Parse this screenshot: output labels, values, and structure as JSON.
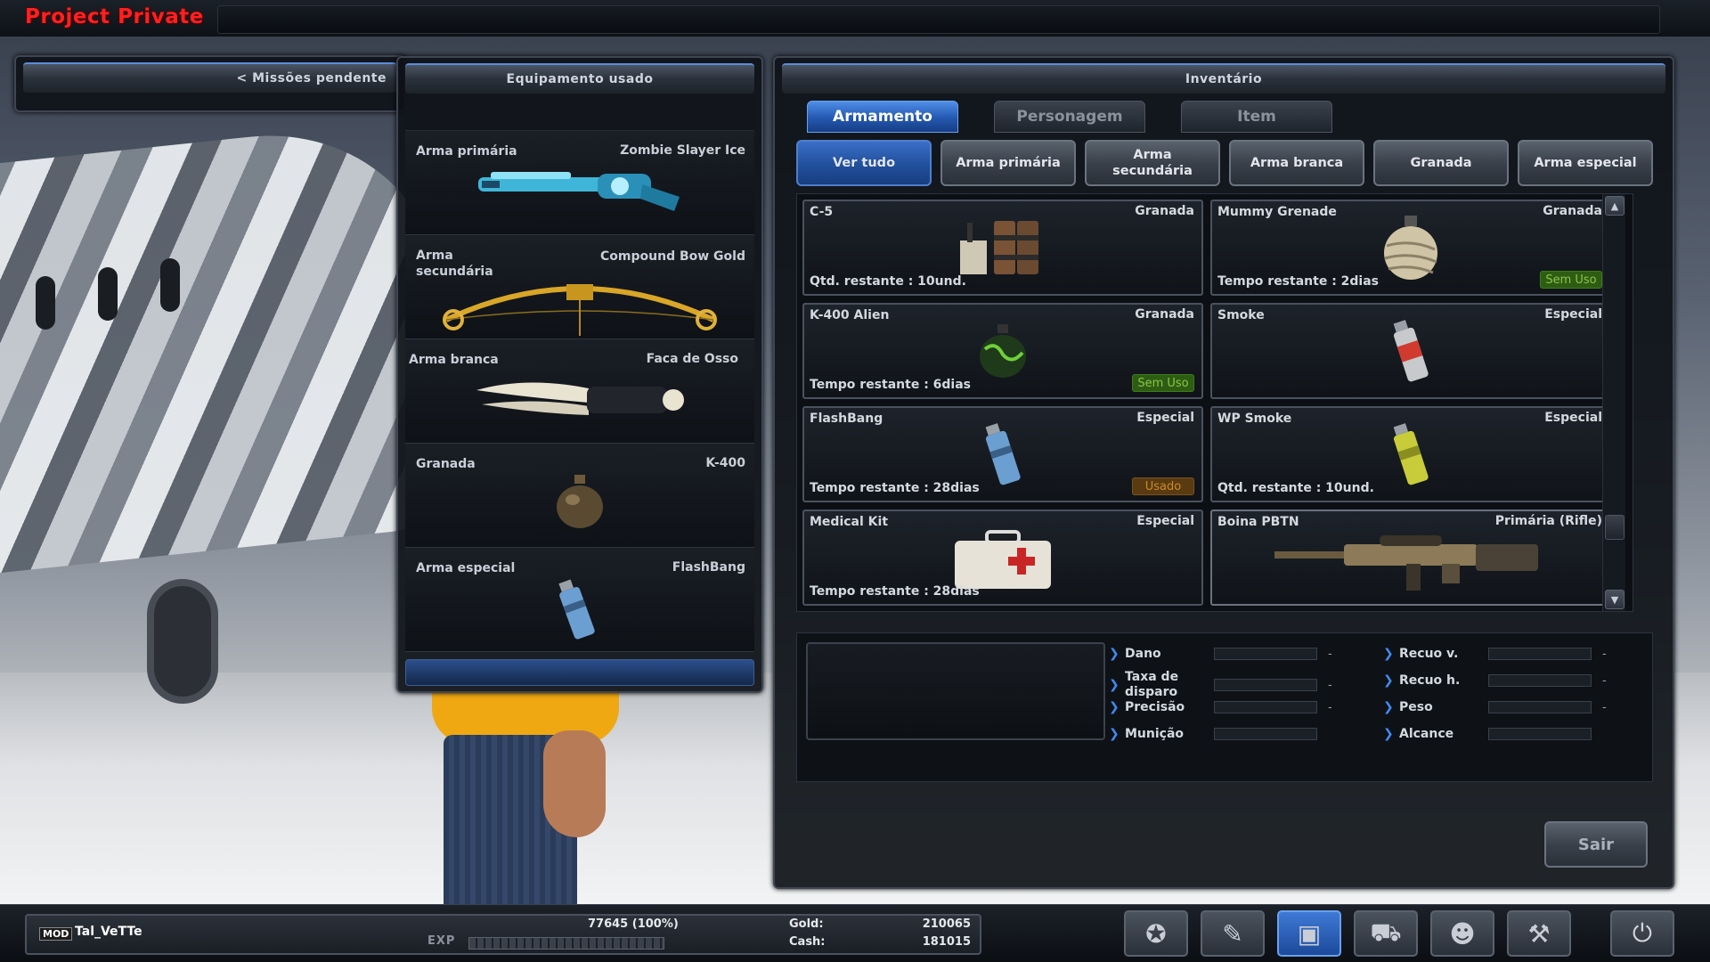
{
  "app": {
    "title": "Project Private"
  },
  "missions": {
    "label": "< Missões pendente"
  },
  "equipment": {
    "title": "Equipamento usado",
    "slots": [
      {
        "type": "Arma primária",
        "name": "Zombie Slayer Ice",
        "icon": "ice-shotgun-icon"
      },
      {
        "type": "Arma secundária",
        "name": "Compound Bow Gold",
        "icon": "gold-bow-icon"
      },
      {
        "type": "Arma branca",
        "name": "Faca de Osso",
        "icon": "bone-knife-icon"
      },
      {
        "type": "Granada",
        "name": "K-400",
        "icon": "grenade-icon"
      },
      {
        "type": "Arma especial",
        "name": "FlashBang",
        "icon": "flashbang-icon"
      }
    ]
  },
  "inventory": {
    "title": "Inventário",
    "tabs": [
      {
        "label": "Armamento",
        "active": true
      },
      {
        "label": "Personagem",
        "active": false
      },
      {
        "label": "Item",
        "active": false
      }
    ],
    "filters": [
      {
        "label": "Ver tudo",
        "active": true
      },
      {
        "label": "Arma primária",
        "active": false
      },
      {
        "label": "Arma secundária",
        "active": false
      },
      {
        "label": "Arma branca",
        "active": false
      },
      {
        "label": "Granada",
        "active": false
      },
      {
        "label": "Arma especial",
        "active": false
      }
    ],
    "items": [
      {
        "name": "C-5",
        "category": "Granada",
        "info": "Qtd. restante : 10und.",
        "badge": "",
        "icon": "c5-explosive-icon"
      },
      {
        "name": "Mummy Grenade",
        "category": "Granada",
        "info": "Tempo restante : 2dias",
        "badge": "Sem Uso",
        "badge_color": "green",
        "icon": "mummy-grenade-icon"
      },
      {
        "name": "K-400 Alien",
        "category": "Granada",
        "info": "Tempo restante : 6dias",
        "badge": "Sem Uso",
        "badge_color": "green",
        "icon": "alien-grenade-icon"
      },
      {
        "name": "Smoke",
        "category": "Especial",
        "info": "",
        "badge": "",
        "icon": "smoke-grenade-icon"
      },
      {
        "name": "FlashBang",
        "category": "Especial",
        "info": "Tempo restante : 28dias",
        "badge": "Usado",
        "badge_color": "orange",
        "icon": "flashbang-icon"
      },
      {
        "name": "WP Smoke",
        "category": "Especial",
        "info": "Qtd. restante : 10und.",
        "badge": "",
        "icon": "wp-smoke-icon"
      },
      {
        "name": "Medical Kit",
        "category": "Especial",
        "info": "Tempo restante : 28dias",
        "badge": "",
        "icon": "medical-kit-icon"
      },
      {
        "name": "Boina PBTN",
        "category": "Primária (Rifle)",
        "info": "",
        "badge": "",
        "icon": "rifle-icon"
      }
    ],
    "stats_left": [
      {
        "label": "Dano",
        "value": "-"
      },
      {
        "label": "Taxa de disparo",
        "value": "-"
      },
      {
        "label": "Precisão",
        "value": "-"
      },
      {
        "label": "Munição",
        "value": ""
      }
    ],
    "stats_right": [
      {
        "label": "Recuo v.",
        "value": "-"
      },
      {
        "label": "Recuo h.",
        "value": "-"
      },
      {
        "label": "Peso",
        "value": "-"
      },
      {
        "label": "Alcance",
        "value": ""
      }
    ],
    "exit_label": "Sair"
  },
  "player": {
    "rank": "MOD",
    "name": "Tal_VeTTe",
    "exp_text": "77645 (100%)",
    "exp_label": "EXP",
    "exp_fraction": 1.0,
    "gold_label": "Gold:",
    "gold_value": "210065",
    "cash_label": "Cash:",
    "cash_value": "181015"
  },
  "nav": [
    {
      "icon": "clan-emblem-icon",
      "active": false
    },
    {
      "icon": "notebook-icon",
      "active": false
    },
    {
      "icon": "inventory-bag-icon",
      "active": true
    },
    {
      "icon": "shop-cart-icon",
      "active": false
    },
    {
      "icon": "community-icon",
      "active": false
    },
    {
      "icon": "settings-wrench-icon",
      "active": false
    },
    {
      "icon": "power-icon",
      "active": false
    }
  ],
  "colors": {
    "accent": "#2458b0",
    "logo": "#ff2020",
    "badge_green": "#8bc34a",
    "badge_orange": "#c98a2c"
  }
}
